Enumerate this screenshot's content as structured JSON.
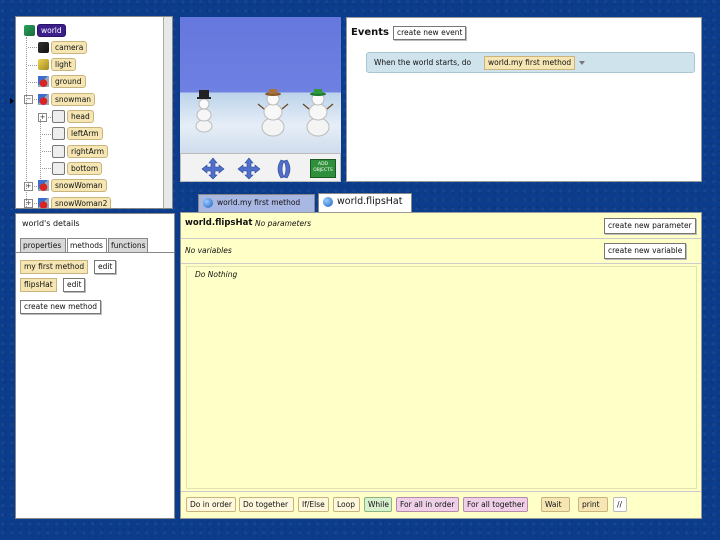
{
  "object_tree": {
    "items": [
      {
        "label": "world",
        "depth": 0,
        "icon": "world-icon",
        "expander": "",
        "selected": true
      },
      {
        "label": "camera",
        "depth": 1,
        "icon": "camera-icon",
        "expander": ""
      },
      {
        "label": "light",
        "depth": 1,
        "icon": "light-icon",
        "expander": ""
      },
      {
        "label": "ground",
        "depth": 1,
        "icon": "object-icon",
        "expander": ""
      },
      {
        "label": "snowman",
        "depth": 1,
        "icon": "object-icon",
        "expander": "−"
      },
      {
        "label": "head",
        "depth": 2,
        "icon": "part-icon",
        "expander": "+"
      },
      {
        "label": "leftArm",
        "depth": 2,
        "icon": "part-icon",
        "expander": ""
      },
      {
        "label": "rightArm",
        "depth": 2,
        "icon": "part-icon",
        "expander": ""
      },
      {
        "label": "bottom",
        "depth": 2,
        "icon": "part-icon",
        "expander": ""
      },
      {
        "label": "snowWoman",
        "depth": 1,
        "icon": "object-icon",
        "expander": "+"
      },
      {
        "label": "snowWoman2",
        "depth": 1,
        "icon": "object-icon",
        "expander": "+"
      }
    ]
  },
  "scene": {
    "add_objects_label": "ADD OBJECTS"
  },
  "events": {
    "title": "Events",
    "create_button": "create new event",
    "event_text": "When the world starts,  do",
    "event_method": "world.my first method"
  },
  "details": {
    "title": "world's details",
    "tabs": [
      "properties",
      "methods",
      "functions"
    ],
    "methods": [
      {
        "name": "my first method",
        "edit": "edit"
      },
      {
        "name": "flipsHat",
        "edit": "edit"
      }
    ],
    "create_method_button": "create new method"
  },
  "editor": {
    "tabs": [
      "world.my first method",
      "world.flipsHat"
    ],
    "method_name": "world.flipsHat",
    "no_params": "No parameters",
    "no_vars": "No variables",
    "create_param": "create new parameter",
    "create_var": "create new variable",
    "body_text": "Do Nothing",
    "controls": [
      "Do in order",
      "Do together",
      "If/Else",
      "Loop",
      "While",
      "For all in order",
      "For all together",
      "Wait",
      "print",
      "//"
    ]
  }
}
